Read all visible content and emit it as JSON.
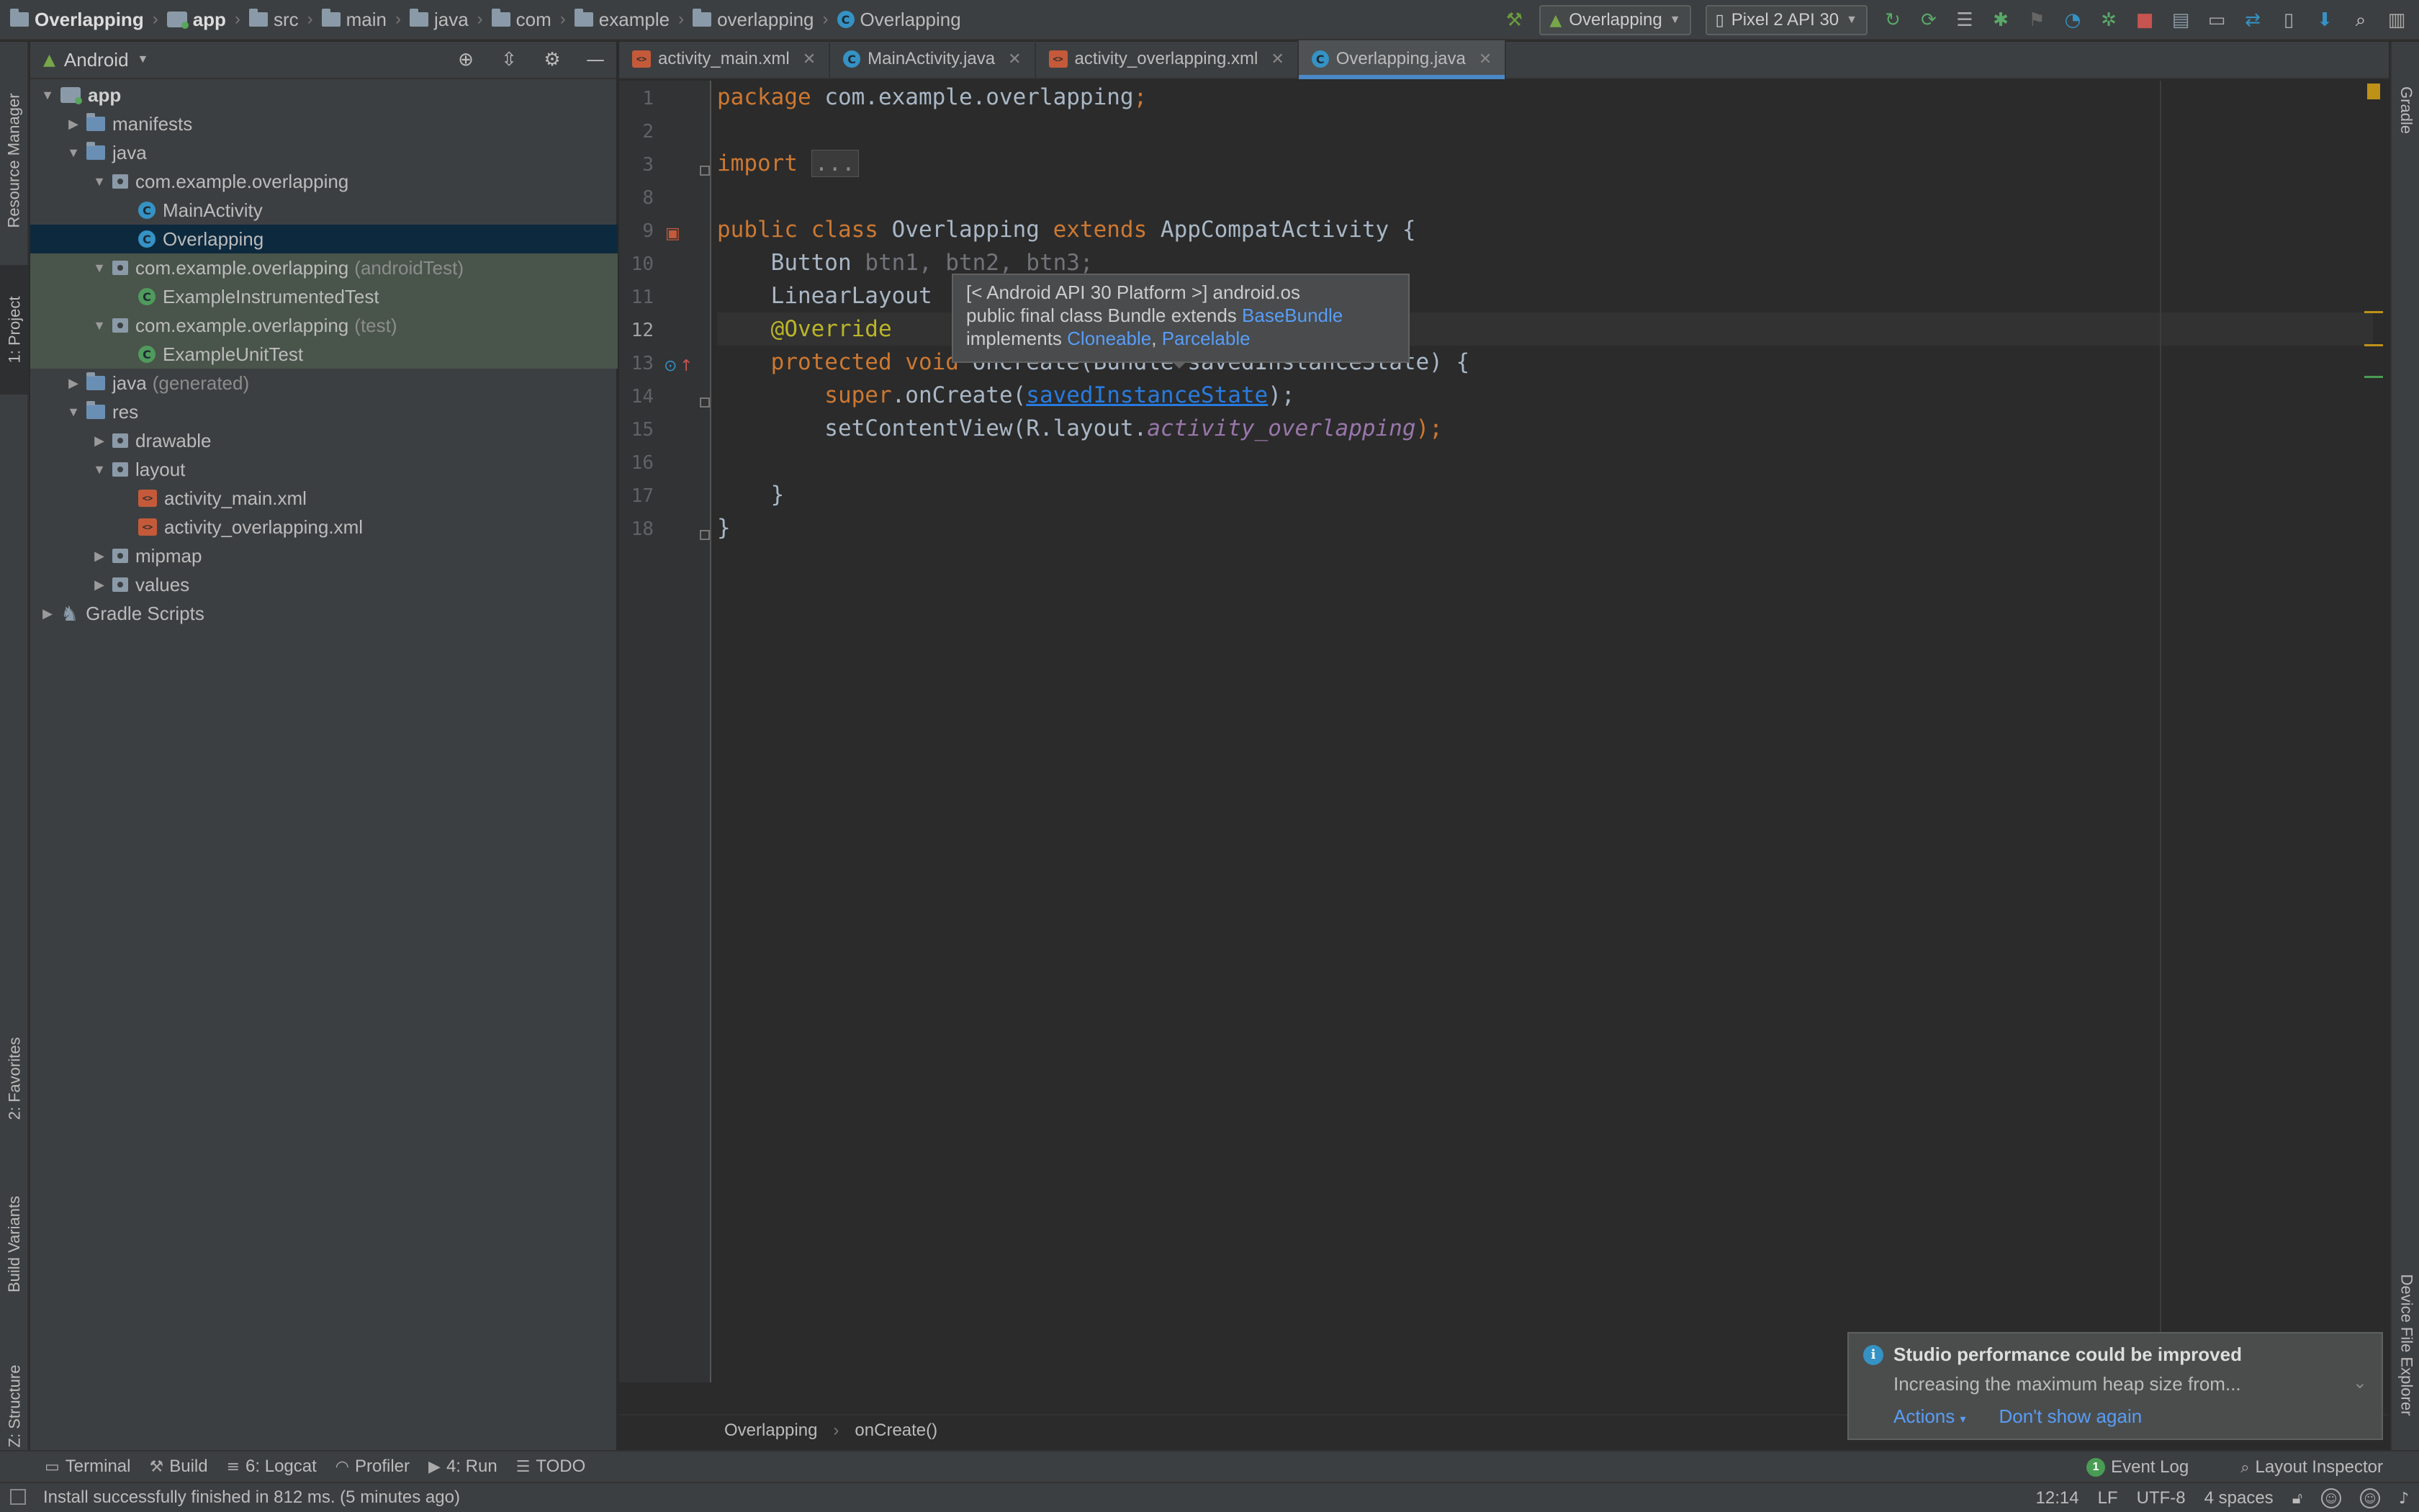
{
  "breadcrumb": {
    "project": "Overlapping",
    "items": [
      "app",
      "src",
      "main",
      "java",
      "com",
      "example",
      "overlapping"
    ],
    "file": "Overlapping"
  },
  "toolbar": {
    "run_config": "Overlapping",
    "device": "Pixel 2 API 30"
  },
  "left_strip": {
    "resource_manager": "Resource Manager",
    "project": "1: Project",
    "favorites": "2: Favorites",
    "build_variants": "Build Variants",
    "structure": "Z: Structure"
  },
  "right_strip": {
    "gradle": "Gradle",
    "device_file_explorer": "Device File Explorer"
  },
  "project_panel": {
    "view": "Android",
    "tree": [
      {
        "label": "app",
        "bold": true
      },
      {
        "label": "manifests"
      },
      {
        "label": "java"
      },
      {
        "label": "com.example.overlapping"
      },
      {
        "label": "MainActivity"
      },
      {
        "label": "Overlapping"
      },
      {
        "label": "com.example.overlapping",
        "suffix": "(androidTest)"
      },
      {
        "label": "ExampleInstrumentedTest"
      },
      {
        "label": "com.example.overlapping",
        "suffix": "(test)"
      },
      {
        "label": "ExampleUnitTest"
      },
      {
        "label": "java",
        "suffix": "(generated)"
      },
      {
        "label": "res"
      },
      {
        "label": "drawable"
      },
      {
        "label": "layout"
      },
      {
        "label": "activity_main.xml"
      },
      {
        "label": "activity_overlapping.xml"
      },
      {
        "label": "mipmap"
      },
      {
        "label": "values"
      },
      {
        "label": "Gradle Scripts"
      }
    ]
  },
  "editor": {
    "tabs": [
      "activity_main.xml",
      "MainActivity.java",
      "activity_overlapping.xml",
      "Overlapping.java"
    ],
    "line_numbers": [
      "1",
      "2",
      "3",
      "8",
      "9",
      "10",
      "11",
      "12",
      "13",
      "14",
      "15",
      "16",
      "17",
      "18"
    ],
    "code": {
      "l1_kw": "package",
      "l1_rest": " com.example.overlapping",
      "l1_semi": ";",
      "l3_kw": "import",
      "l3_fold": "...",
      "l9_kw1": "public class",
      "l9_name": " Overlapping ",
      "l9_kw2": "extends",
      "l9_rest": " AppCompatActivity {",
      "l10_type": "    Button ",
      "l10_vars": "btn1, btn2, btn3;",
      "l11_type": "    LinearLayout",
      "l12_ann": "    @Override",
      "l13_kw": "    protected void",
      "l13_rest": " onCreate(Bundle savedInstanceState) {",
      "l14_kw": "        super",
      "l14_mid": ".onCreate(",
      "l14_arg": "savedInstanceState",
      "l14_end": ");",
      "l15_pre": "        setContentView(R.layout.",
      "l15_ref": "activity_overlapping",
      "l15_end": ");",
      "l17": "    }",
      "l18": "}"
    },
    "popup": {
      "line1": "[< Android API 30 Platform >] android.os",
      "line2_pre": "public final class Bundle extends ",
      "line2_link": "BaseBundle",
      "line3_pre": "implements ",
      "line3_link1": "Cloneable",
      "line3_sep": ", ",
      "line3_link2": "Parcelable"
    },
    "breadcrumb": [
      "Overlapping",
      "onCreate()"
    ]
  },
  "notification": {
    "title": "Studio performance could be improved",
    "message": "Increasing the maximum heap size from...",
    "action1": "Actions",
    "action2": "Don't show again"
  },
  "bottom_tools": {
    "terminal": "Terminal",
    "build": "Build",
    "logcat": "6: Logcat",
    "profiler": "Profiler",
    "run": "4: Run",
    "todo": "TODO",
    "event_log": "Event Log",
    "event_count": "1",
    "layout_inspector": "Layout Inspector"
  },
  "status": {
    "message": "Install successfully finished in 812 ms. (5 minutes ago)",
    "position": "12:14",
    "line_sep": "LF",
    "encoding": "UTF-8",
    "indent": "4 spaces"
  },
  "colors": {
    "background": "#2b2b2b",
    "panel": "#3c3f41",
    "keyword": "#cc7832",
    "accent": "#4a88c7",
    "link": "#589df6"
  }
}
